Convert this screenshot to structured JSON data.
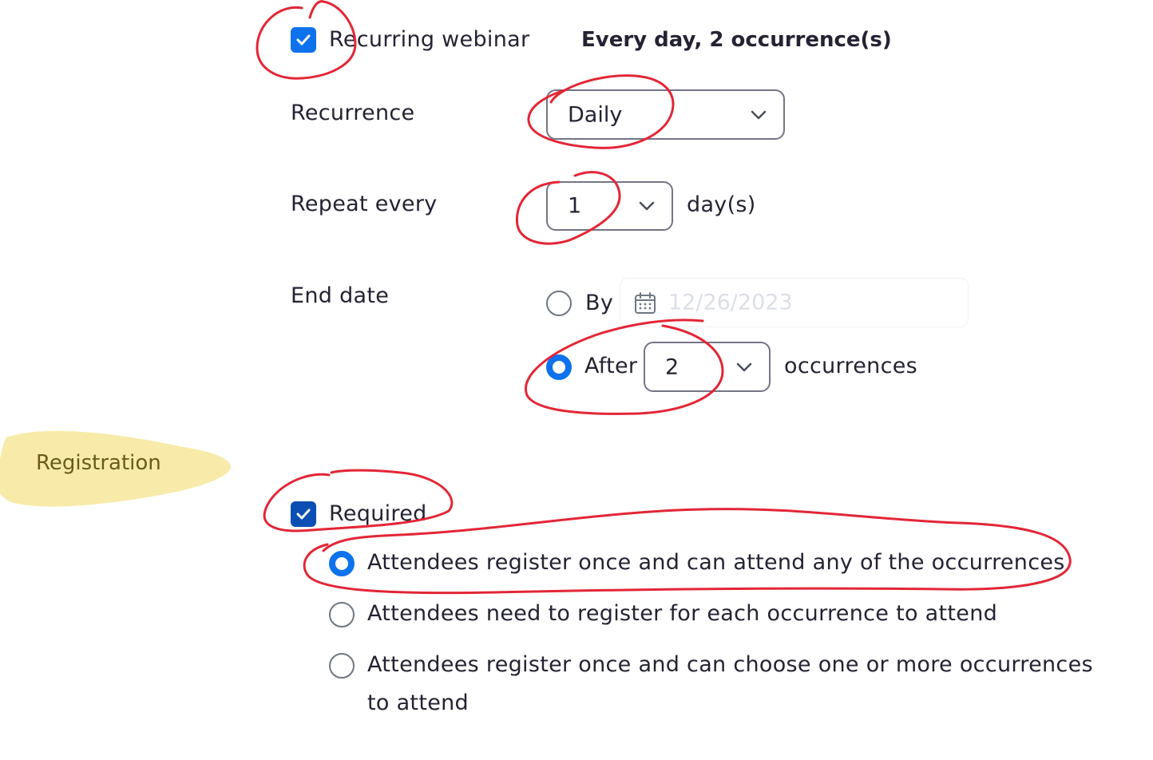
{
  "recurring": {
    "checkbox_label": "Recurring webinar",
    "checked": true,
    "summary": "Every day, 2 occurrence(s)"
  },
  "recurrence": {
    "label": "Recurrence",
    "value": "Daily"
  },
  "repeat_every": {
    "label": "Repeat every",
    "value": "1",
    "unit": "day(s)"
  },
  "end_date": {
    "label": "End date",
    "by_label": "By",
    "by_selected": false,
    "date_value": "12/26/2023",
    "after_label": "After",
    "after_selected": true,
    "after_value": "2",
    "after_unit": "occurrences"
  },
  "registration": {
    "title": "Registration",
    "required_label": "Required",
    "required_checked": true,
    "options": [
      {
        "label": "Attendees register once and can attend any of the occurrences",
        "selected": true
      },
      {
        "label": "Attendees need to register for each occurrence to attend",
        "selected": false
      },
      {
        "label": "Attendees register once and can choose one or more occurrences",
        "label_line2": "to attend",
        "selected": false
      }
    ]
  },
  "icons": {
    "checkmark": "check-icon",
    "dropdown": "chevron-down-icon",
    "calendar": "calendar-icon"
  },
  "colors": {
    "accent": "#0e72ed",
    "required_checkbox": "#0b4fb5",
    "annotation_red": "#e32636",
    "highlighter_yellow": "#f7e89a",
    "text": "#232333"
  }
}
